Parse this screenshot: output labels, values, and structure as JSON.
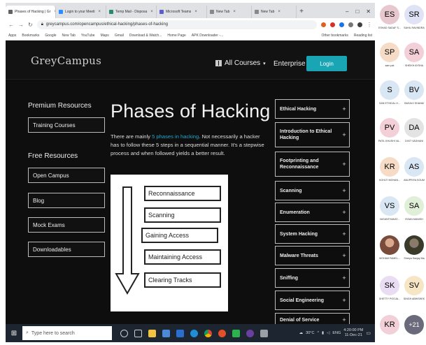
{
  "browser": {
    "tabs": [
      {
        "label": "Phases of Hacking | Gr",
        "active": true
      },
      {
        "label": "Login to your Meeti",
        "active": false
      },
      {
        "label": "Temp Mail - Disposa",
        "active": false
      },
      {
        "label": "Microsoft Teams",
        "active": false
      },
      {
        "label": "New Tab",
        "active": false
      },
      {
        "label": "New Tab",
        "active": false
      }
    ],
    "url": "greycampus.com/opencampus/ethical-hacking/phases-of-hacking",
    "bookmarks": [
      "Apps",
      "Bookmarks",
      "Google",
      "New Tab",
      "YouTube",
      "Maps",
      "Gmail",
      "Download & Watch...",
      "Home Page",
      "APK Downloader -..."
    ],
    "bookmarks_right": [
      "Other bookmarks",
      "Reading list"
    ]
  },
  "site": {
    "logo": "GreyCampus",
    "all_courses": "All Courses",
    "enterprise": "Enterprise",
    "login": "Login"
  },
  "sidebar": {
    "premium_heading": "Premium Resources",
    "premium_items": [
      "Training Courses"
    ],
    "free_heading": "Free Resources",
    "free_items": [
      "Open Campus",
      "Blog",
      "Mock Exams",
      "Downloadables"
    ]
  },
  "article": {
    "title": "Phases of Hacking",
    "intro_prefix": "There are mainly ",
    "intro_link": "5 phases in hacking",
    "intro_suffix": ". Not necessarily a hacker has to follow these 5 steps in a sequential manner. It's a stepwise process and when followed yields a better result.",
    "diagram_stages": [
      "Reconnaissance",
      "Scanning",
      "Gaining Access",
      "Maintaining Access",
      "Clearing Tracks"
    ]
  },
  "topics": [
    "Ethical Hacking",
    "Introduction to Ethical Hacking",
    "Footprinting and Reconnaissance",
    "Scanning",
    "Enumeration",
    "System Hacking",
    "Malware Threats",
    "Sniffing",
    "Social Engineering",
    "Denial of Service"
  ],
  "taskbar": {
    "search_placeholder": "Type here to search",
    "weather": "30°C",
    "lang": "ENG",
    "time": "4:20:00 PM",
    "date": "11-Dec-21"
  },
  "participants": [
    {
      "initials": "ES",
      "name": "ESHAD SADAF S...",
      "color": "#e8c8cf"
    },
    {
      "initials": "SR",
      "name": "SAHIL RAVINDRA",
      "color": "#dfe3f5"
    },
    {
      "initials": "SP",
      "name": "sam pat",
      "color": "#f6dcc6"
    },
    {
      "initials": "SA",
      "name": "SHEIKH AYSHA",
      "color": "#f3cfd7"
    },
    {
      "initials": "S",
      "name": "SAN ETHICAL H...",
      "color": "#d9e6f3"
    },
    {
      "initials": "BV",
      "name": "BASAVJ SHANM",
      "color": "#d9e6f3"
    },
    {
      "initials": "PV",
      "name": "PATIL KHUSHI VA...",
      "color": "#f3cfd7"
    },
    {
      "initials": "DA",
      "name": "DIXIT VAGHANI",
      "color": "#e3e3e3"
    },
    {
      "initials": "KR",
      "name": "KOHLTI MOHAN...",
      "color": "#f6dcc6"
    },
    {
      "initials": "AS",
      "name": "ANUPRIYA SOUM",
      "color": "#d9e6f3"
    },
    {
      "initials": "VS",
      "name": "VASANTHAKAT...",
      "color": "#d9e6f3"
    },
    {
      "initials": "SA",
      "name": "ISSAN MANISH",
      "color": "#e0f0d8"
    },
    {
      "initials": "",
      "name": "MOHAM FAMEL...",
      "color": "#b98a7a"
    },
    {
      "initials": "",
      "name": "Shreya Sanjay Ma",
      "color": "#5a5a4a"
    },
    {
      "initials": "SK",
      "name": "SHETTY POOJA...",
      "color": "#e8ddf3"
    },
    {
      "initials": "SV",
      "name": "SINGH ABHISHEK",
      "color": "#f6e6c6"
    },
    {
      "initials": "KR",
      "name": "",
      "color": "#f3cfd7"
    },
    {
      "initials": "+21",
      "name": "",
      "color": "#6a6a7a"
    }
  ]
}
